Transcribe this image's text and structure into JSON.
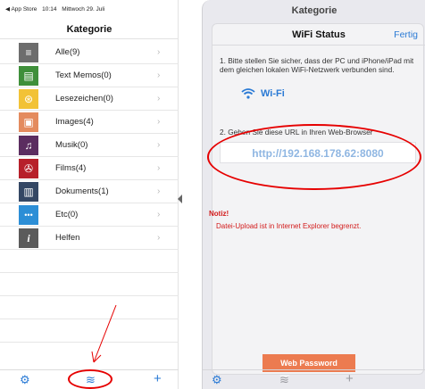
{
  "status_bar": {
    "back_app": "◀ App Store",
    "time": "10:14",
    "date": "Mittwoch 29. Juli"
  },
  "left": {
    "title": "Kategorie",
    "categories": [
      {
        "label": "Alle(9)",
        "icon": "list-icon",
        "color": "#6d6d6d",
        "glyph": "≡"
      },
      {
        "label": "Text Memos(0)",
        "icon": "memo-icon",
        "color": "#3f8f3a",
        "glyph": "▤"
      },
      {
        "label": "Lesezeichen(0)",
        "icon": "bookmark-icon",
        "color": "#f2c236",
        "glyph": "⊛"
      },
      {
        "label": "Images(4)",
        "icon": "image-icon",
        "color": "#e48b5e",
        "glyph": "▣"
      },
      {
        "label": "Musik(0)",
        "icon": "music-icon",
        "color": "#5b2d60",
        "glyph": "♫"
      },
      {
        "label": "Films(4)",
        "icon": "film-icon",
        "color": "#b7202a",
        "glyph": "✇"
      },
      {
        "label": "Dokuments(1)",
        "icon": "document-icon",
        "color": "#344764",
        "glyph": "▥"
      },
      {
        "label": "Etc(0)",
        "icon": "more-icon",
        "color": "#2c8ed6",
        "glyph": "•••"
      },
      {
        "label": "Helfen",
        "icon": "info-icon",
        "color": "#5b5b5b",
        "glyph": "i"
      }
    ],
    "chevron": "›"
  },
  "toolbar_icons": {
    "settings": "⚙",
    "wifi": "≋",
    "add": "+"
  },
  "colors": {
    "accent": "#2a7ad5",
    "annotation_red": "#e60000",
    "button_orange": "#ec7b50"
  },
  "right": {
    "top_title": "Kategorie",
    "sheet_title": "WiFi Status",
    "done_label": "Fertig",
    "step1": "1. Bitte stellen Sie sicher, dass der PC und iPhone/iPad mit dem gleichen lokalen WiFi-Netzwerk verbunden sind.",
    "wifi_label": "Wi-Fi",
    "step2": "2. Geben Sie diese URL in Ihren Web-Browser",
    "url": "http://192.168.178.62:8080",
    "notice_title": "Notiz!",
    "notice_text": "Datei-Upload ist in Internet Explorer begrenzt.",
    "password_button": "Web Password"
  }
}
